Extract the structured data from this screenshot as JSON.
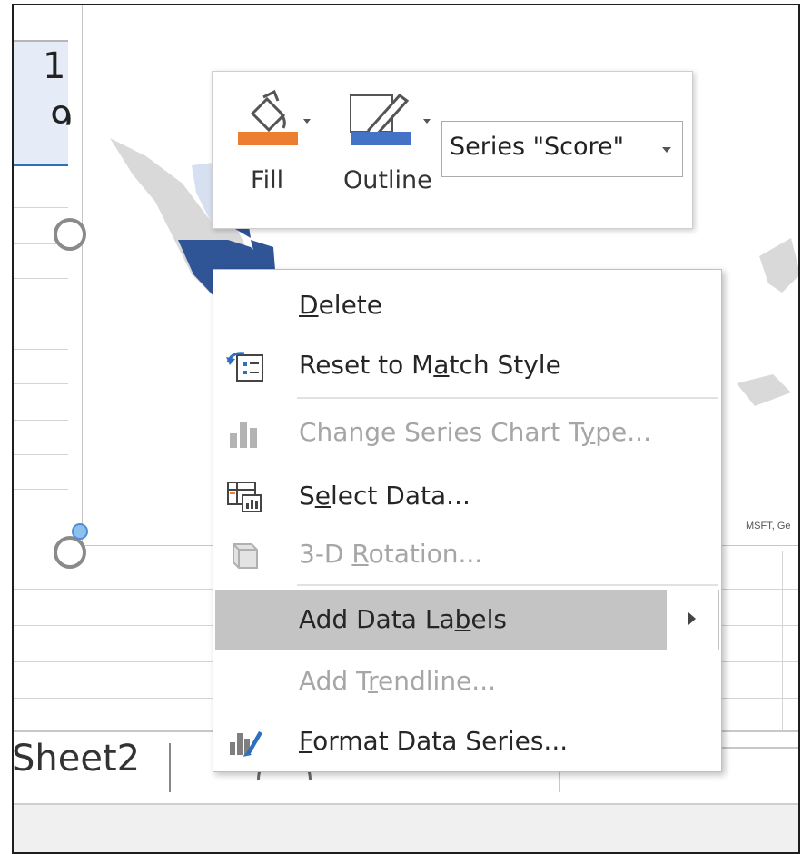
{
  "sheet": {
    "cells": [
      "1",
      "9"
    ],
    "tab_label": "Sheet2"
  },
  "chart": {
    "attribution": "MSFT, Ge",
    "colors": {
      "dark": "#2f5597",
      "light": "#d6e0f0",
      "land": "#d9d9d9"
    }
  },
  "mini_toolbar": {
    "fill_label": "Fill",
    "outline_label": "Outline",
    "fill_color": "#ed7d31",
    "outline_color": "#4472c4",
    "series_selector_value": "Series \"Score\""
  },
  "context_menu": {
    "items": [
      {
        "pre": "",
        "key": "D",
        "post": "elete",
        "icon": "none",
        "enabled": true
      },
      {
        "pre": "Reset to M",
        "key": "a",
        "post": "tch Style",
        "icon": "reset-style-icon",
        "enabled": true
      },
      {
        "pre": "Change Series Chart T",
        "key": "y",
        "post": "pe...",
        "icon": "bar-chart-icon",
        "enabled": false
      },
      {
        "pre": "S",
        "key": "e",
        "post": "lect Data...",
        "icon": "select-data-icon",
        "enabled": true
      },
      {
        "pre": "3-D ",
        "key": "R",
        "post": "otation...",
        "icon": "cube-icon",
        "enabled": false
      },
      {
        "pre": "Add Data La",
        "key": "b",
        "post": "els",
        "icon": "none",
        "enabled": true,
        "highlighted": true,
        "submenu": true
      },
      {
        "pre": "Add T",
        "key": "r",
        "post": "endline...",
        "icon": "none",
        "enabled": false
      },
      {
        "pre": "",
        "key": "F",
        "post": "ormat Data Series...",
        "icon": "format-series-icon",
        "enabled": true
      }
    ]
  }
}
